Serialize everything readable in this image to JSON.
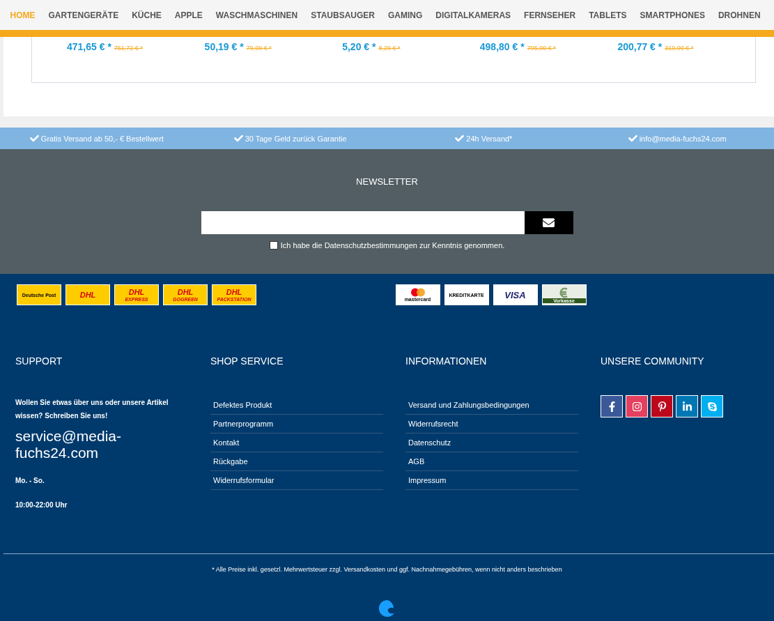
{
  "nav": [
    {
      "label": "HOME",
      "selected": true
    },
    {
      "label": "GARTENGERÄTE",
      "selected": false
    },
    {
      "label": "KÜCHE",
      "selected": false
    },
    {
      "label": "APPLE",
      "selected": false
    },
    {
      "label": "WASCHMASCHINEN",
      "selected": false
    },
    {
      "label": "STAUBSAUGER",
      "selected": false
    },
    {
      "label": "GAMING",
      "selected": false
    },
    {
      "label": "DIGITALKAMERAS",
      "selected": false
    },
    {
      "label": "FERNSEHER",
      "selected": false
    },
    {
      "label": "TABLETS",
      "selected": false
    },
    {
      "label": "SMARTPHONES",
      "selected": false
    },
    {
      "label": "DROHNEN",
      "selected": false
    }
  ],
  "products": [
    {
      "price": "471,65 € *",
      "old_price": "751,72 € *"
    },
    {
      "price": "50,19 € *",
      "old_price": "79,99 € *"
    },
    {
      "price": "5,20 € *",
      "old_price": "8,29 € *"
    },
    {
      "price": "498,80 € *",
      "old_price": "795,00 € *"
    },
    {
      "price": "200,77 € *",
      "old_price": "319,99 € *"
    }
  ],
  "benefits": [
    "Gratis Versand ab 50,- € Bestellwert",
    "30 Tage Geld zurück Garantie",
    "24h Versand*",
    "info@media-fuchs24.com"
  ],
  "newsletter": {
    "title": "NEWSLETTER",
    "consent": {
      "label": "Ich habe die Datenschutzbestimmungen zur Kenntnis genommen.",
      "checked": false
    }
  },
  "shipping_logos": [
    {
      "kind": "post",
      "text": "Deutsche Post"
    },
    {
      "kind": "dhl",
      "text": "DHL"
    },
    {
      "kind": "dhl",
      "text": "DHL",
      "sub": "EXPRESS"
    },
    {
      "kind": "dhl",
      "text": "DHL",
      "sub": "GOGREEN"
    },
    {
      "kind": "dhl",
      "text": "DHL",
      "sub": "PACKSTATION"
    }
  ],
  "payment_logos": [
    {
      "kind": "mastercard",
      "text": "mastercard"
    },
    {
      "kind": "plain",
      "text": "KREDITKARTE"
    },
    {
      "kind": "visa",
      "text": "VISA"
    },
    {
      "kind": "vorkasse",
      "text": "Vorkasse"
    }
  ],
  "support": {
    "title": "SUPPORT",
    "intro": "Wollen Sie etwas über uns oder unsere Artikel wissen? Schreiben Sie uns!",
    "email": "service@media-fuchs24.com",
    "days": "Mo. - So.",
    "hours": "10:00-22:00 Uhr"
  },
  "shop_service": {
    "title": "SHOP SERVICE",
    "links": [
      "Defektes Produkt",
      "Partnerprogramm",
      "Kontakt",
      "Rückgabe",
      "Widerrufsformular"
    ]
  },
  "informationen": {
    "title": "INFORMATIONEN",
    "links": [
      "Versand und Zahlungsbedingungen",
      "Widerrufsrecht",
      "Datenschutz",
      "AGB",
      "Impressum"
    ]
  },
  "community": {
    "title": "UNSERE COMMUNITY",
    "social": [
      {
        "kind": "facebook",
        "color": "#3b5998"
      },
      {
        "kind": "instagram",
        "color": "#e4405f"
      },
      {
        "kind": "pinterest",
        "color": "#bd081c"
      },
      {
        "kind": "linkedin",
        "color": "#0077b5"
      },
      {
        "kind": "skype",
        "color": "#00aff0"
      }
    ]
  },
  "footnote": "* Alle Preise inkl. gesetzl. Mehrwertsteuer zzgl. Versandkosten und ggf. Nachnahmegebühren, wenn nicht anders beschrieben"
}
